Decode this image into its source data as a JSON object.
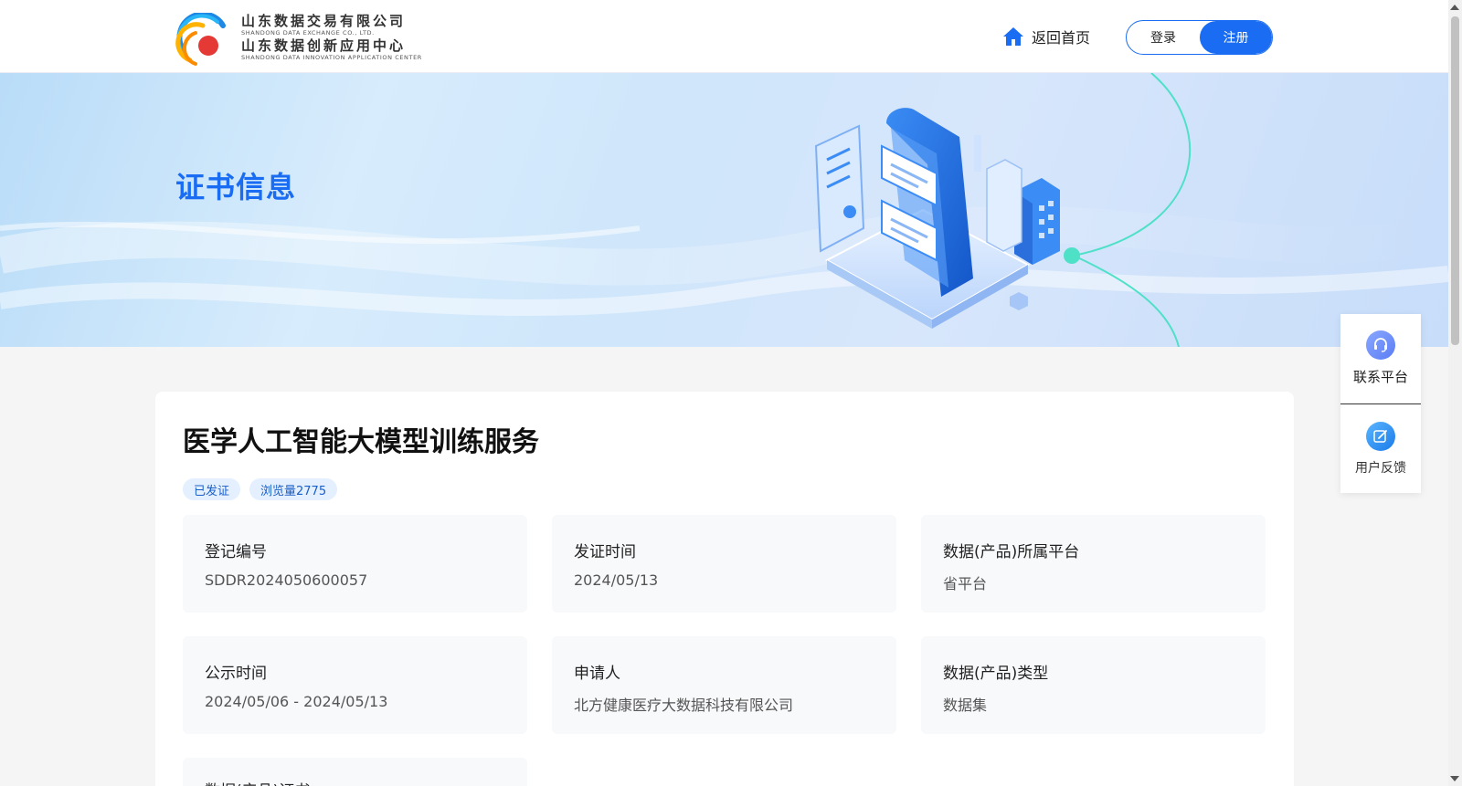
{
  "header": {
    "logo": {
      "line1_cn": "山东数据交易有限公司",
      "line1_en": "SHANDONG DATA EXCHANGE CO., LTD.",
      "line2_cn": "山东数据创新应用中心",
      "line2_en": "SHANDONG DATA INNOVATION APPLICATION CENTER"
    },
    "home_label": "返回首页",
    "login_label": "登录",
    "register_label": "注册"
  },
  "banner": {
    "title": "证书信息"
  },
  "certificate": {
    "title": "医学人工智能大模型训练服务",
    "tags": [
      "已发证",
      "浏览量2775"
    ],
    "fields": [
      {
        "label": "登记编号",
        "value": "SDDR2024050600057"
      },
      {
        "label": "发证时间",
        "value": "2024/05/13"
      },
      {
        "label": "数据(产品)所属平台",
        "value": "省平台"
      },
      {
        "label": "公示时间",
        "value": "2024/05/06 - 2024/05/13"
      },
      {
        "label": "申请人",
        "value": "北方健康医疗大数据科技有限公司"
      },
      {
        "label": "数据(产品)类型",
        "value": "数据集"
      },
      {
        "label": "数据(产品)证书",
        "value": ""
      }
    ]
  },
  "side_float": {
    "contact_label": "联系平台",
    "feedback_label": "用户反馈"
  },
  "colors": {
    "primary": "#1a6df2",
    "tag_bg": "#e4efff",
    "field_bg": "#f8f9fb"
  },
  "icons": {
    "home": "home-icon",
    "contact": "headset-icon",
    "feedback": "edit-icon"
  }
}
